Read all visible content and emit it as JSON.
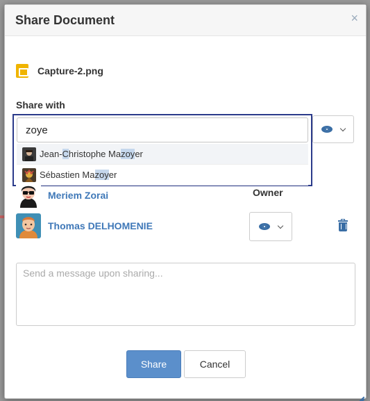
{
  "dialog": {
    "title": "Share Document",
    "close_glyph": "×"
  },
  "file": {
    "icon": "image-file-icon",
    "name": "Capture-2.png"
  },
  "share_with": {
    "label": "Share with",
    "input_value": "zoye",
    "suggestions": [
      {
        "parts": [
          "Jean-",
          "C",
          "hristophe Ma",
          "zoy",
          "er"
        ],
        "highlighted": [
          1,
          3
        ]
      },
      {
        "parts": [
          "Sébastien Ma",
          "zoy",
          "er"
        ],
        "highlighted": [
          1
        ]
      }
    ]
  },
  "members": [
    {
      "name": "Meriem Zorai",
      "role": "Owner"
    },
    {
      "name": "Thomas DELHOMENIE"
    }
  ],
  "message": {
    "placeholder": "Send a message upon sharing..."
  },
  "actions": {
    "share_label": "Share",
    "cancel_label": "Cancel"
  },
  "colors": {
    "accent": "#3a6ea5",
    "primary_button": "#5b8fcb",
    "focus_border": "#2a3a8a"
  }
}
